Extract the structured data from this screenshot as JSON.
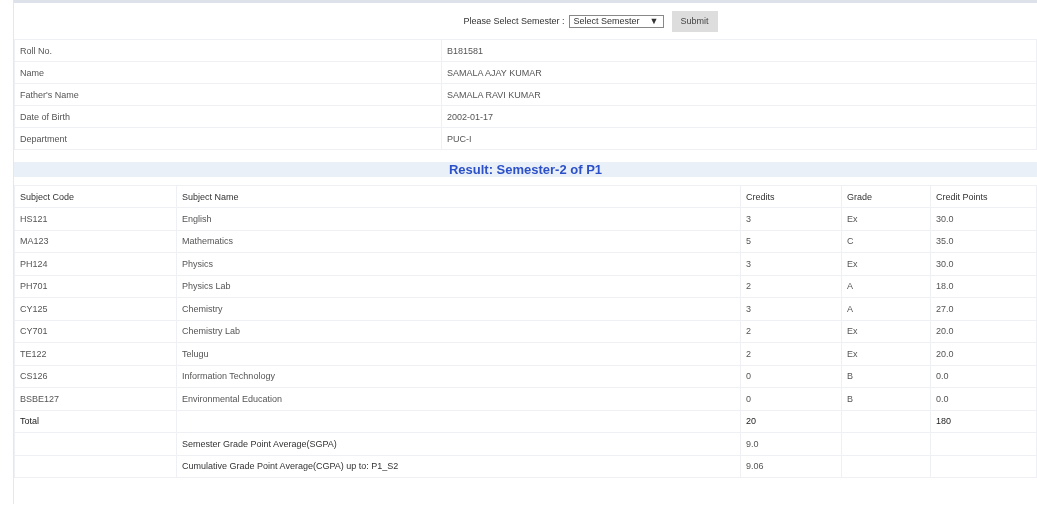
{
  "semester_form": {
    "label": "Please Select Semester :",
    "select": {
      "value": "Select Semester",
      "arrow": "▼"
    },
    "submit": "Submit"
  },
  "student_info": [
    {
      "label": "Roll No.",
      "value": "B181581"
    },
    {
      "label": "Name",
      "value": "SAMALA AJAY KUMAR"
    },
    {
      "label": "Father's Name",
      "value": "SAMALA RAVI KUMAR"
    },
    {
      "label": "Date of Birth",
      "value": "2002-01-17"
    },
    {
      "label": "Department",
      "value": "PUC-I"
    }
  ],
  "result_title": "Result: Semester-2 of P1",
  "result_table": {
    "columns": [
      "Subject Code",
      "Subject Name",
      "Credits",
      "Grade",
      "Credit Points"
    ],
    "rows": [
      {
        "kind": "subject",
        "code": "HS121",
        "name": "English",
        "credits": "3",
        "grade": "Ex",
        "points": "30.0"
      },
      {
        "kind": "subject",
        "code": "MA123",
        "name": "Mathematics",
        "credits": "5",
        "grade": "C",
        "points": "35.0"
      },
      {
        "kind": "subject",
        "code": "PH124",
        "name": "Physics",
        "credits": "3",
        "grade": "Ex",
        "points": "30.0"
      },
      {
        "kind": "subject",
        "code": "PH701",
        "name": "Physics Lab",
        "credits": "2",
        "grade": "A",
        "points": "18.0"
      },
      {
        "kind": "subject",
        "code": "CY125",
        "name": "Chemistry",
        "credits": "3",
        "grade": "A",
        "points": "27.0"
      },
      {
        "kind": "subject",
        "code": "CY701",
        "name": "Chemistry Lab",
        "credits": "2",
        "grade": "Ex",
        "points": "20.0"
      },
      {
        "kind": "subject",
        "code": "TE122",
        "name": "Telugu",
        "credits": "2",
        "grade": "Ex",
        "points": "20.0"
      },
      {
        "kind": "subject",
        "code": "CS126",
        "name": "Information Technology",
        "credits": "0",
        "grade": "B",
        "points": "0.0"
      },
      {
        "kind": "subject",
        "code": "BSBE127",
        "name": "Environmental Education",
        "credits": "0",
        "grade": "B",
        "points": "0.0"
      },
      {
        "kind": "total",
        "code": "Total",
        "credits": "20",
        "points": "180"
      },
      {
        "kind": "average",
        "name": "Semester Grade Point Average(SGPA)",
        "credits": "9.0"
      },
      {
        "kind": "average",
        "name": "Cumulative Grade Point Average(CGPA) up to: P1_S2",
        "credits": "9.06"
      }
    ]
  }
}
